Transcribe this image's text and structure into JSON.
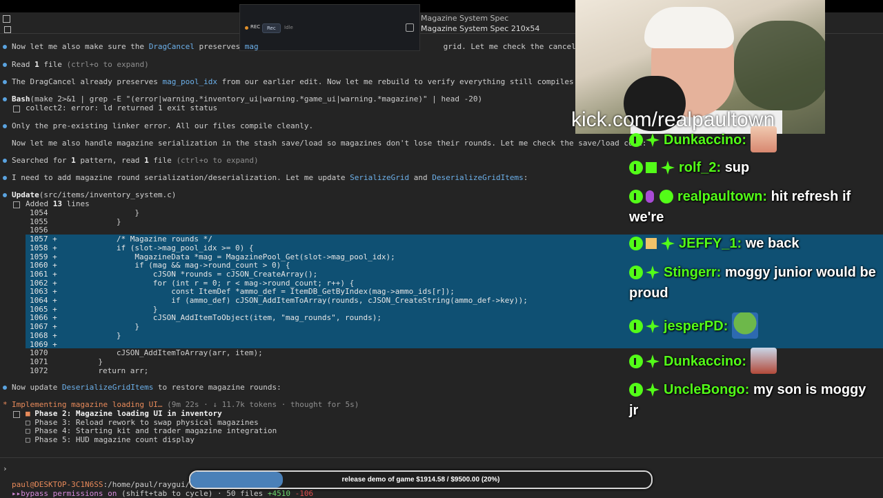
{
  "window": {
    "title": "Magazine System Spec",
    "subtitle": "Magazine System Spec 210x54"
  },
  "recorder": {
    "rec_label": "REC",
    "rec_button": "Rec",
    "idle_button": "Idle"
  },
  "messages": {
    "m1_a": "Now let me also make sure the ",
    "m1_b": "DragCancel",
    "m1_c": " preserves ",
    "m1_d": "mag",
    "m1_e": "grid. Let me check the cancel path:",
    "m2_a": "Read ",
    "m2_b": "1",
    "m2_c": " file ",
    "m2_d": "(ctrl+o to expand)",
    "m3_a": "The DragCancel already preserves ",
    "m3_b": "mag_pool_idx",
    "m3_c": " from our earlier edit. Now let me rebuild to verify everything still compiles:",
    "m4_a": "Bash",
    "m4_b": "(make 2>&1 | grep -E \"(error|warning.*inventory_ui|warning.*game_ui|warning.*magazine)\" | head -20)",
    "m4_c": "collect2: error: ld returned 1 exit status",
    "m5": "Only the pre-existing linker error. All our files compile cleanly.",
    "m6": "Now let me also handle magazine serialization in the stash save/load so magazines don't lose their rounds. Let me check the save/load code:",
    "m7_a": "Searched for ",
    "m7_b": "1",
    "m7_c": " pattern, read ",
    "m7_d": "1",
    "m7_e": " file ",
    "m7_f": "(ctrl+o to expand)",
    "m8_a": "I need to add magazine round serialization/deserialization. Let me update ",
    "m8_b": "SerializeGrid",
    "m8_c": " and ",
    "m8_d": "DeserializeGridItems",
    "m8_e": ":",
    "m9_a": "Update",
    "m9_b": "(src/items/inventory_system.c)",
    "m9_c_a": "Added ",
    "m9_c_b": "13",
    "m9_c_c": " lines",
    "m10_a": "Now update ",
    "m10_b": "DeserializeGridItems",
    "m10_c": " to restore magazine rounds:",
    "m11_a": "Implementing magazine loading UI… ",
    "m11_b": "(9m 22s · ↓ 11.7k tokens · thought for 5s)"
  },
  "code_lines": [
    {
      "n": "1054",
      "s": " ",
      "t": "                }"
    },
    {
      "n": "1055",
      "s": " ",
      "t": "            }"
    },
    {
      "n": "1056",
      "s": " ",
      "t": ""
    },
    {
      "n": "1057",
      "s": "+",
      "t": "            /* Magazine rounds */"
    },
    {
      "n": "1058",
      "s": "+",
      "t": "            if (slot->mag_pool_idx >= 0) {"
    },
    {
      "n": "1059",
      "s": "+",
      "t": "                MagazineData *mag = MagazinePool_Get(slot->mag_pool_idx);"
    },
    {
      "n": "1060",
      "s": "+",
      "t": "                if (mag && mag->round_count > 0) {"
    },
    {
      "n": "1061",
      "s": "+",
      "t": "                    cJSON *rounds = cJSON_CreateArray();"
    },
    {
      "n": "1062",
      "s": "+",
      "t": "                    for (int r = 0; r < mag->round_count; r++) {"
    },
    {
      "n": "1063",
      "s": "+",
      "t": "                        const ItemDef *ammo_def = ItemDB_GetByIndex(mag->ammo_ids[r]);"
    },
    {
      "n": "1064",
      "s": "+",
      "t": "                        if (ammo_def) cJSON_AddItemToArray(rounds, cJSON_CreateString(ammo_def->key));"
    },
    {
      "n": "1065",
      "s": "+",
      "t": "                    }"
    },
    {
      "n": "1066",
      "s": "+",
      "t": "                    cJSON_AddItemToObject(item, \"mag_rounds\", rounds);"
    },
    {
      "n": "1067",
      "s": "+",
      "t": "                }"
    },
    {
      "n": "1068",
      "s": "+",
      "t": "            }"
    },
    {
      "n": "1069",
      "s": "+",
      "t": ""
    },
    {
      "n": "1070",
      "s": " ",
      "t": "            cJSON_AddItemToArray(arr, item);"
    },
    {
      "n": "1071",
      "s": " ",
      "t": "        }"
    },
    {
      "n": "1072",
      "s": " ",
      "t": "        return arr;"
    }
  ],
  "todos": [
    {
      "mark": "■",
      "text": "Phase 2: Magazine loading UI in inventory",
      "active": true
    },
    {
      "mark": "□",
      "text": "Phase 3: Reload rework to swap physical magazines",
      "active": false
    },
    {
      "mark": "□",
      "text": "Phase 4: Starting kit and trader magazine integration",
      "active": false
    },
    {
      "mark": "□",
      "text": "Phase 5: HUD magazine count display",
      "active": false
    }
  ],
  "stream": {
    "url": "kick.com/realpaultown"
  },
  "chat": [
    {
      "user": "Dunkaccino:",
      "msg": ""
    },
    {
      "user": "rolf_2:",
      "msg": "sup"
    },
    {
      "user": "realpaultown:",
      "msg": "hit refresh if we're"
    },
    {
      "user": "JEFFY_1:",
      "msg": "we back"
    },
    {
      "user": "Stingerr:",
      "msg": "moggy junior would be proud"
    },
    {
      "user": "jesperPD:",
      "msg": ""
    },
    {
      "user": "Dunkaccino:",
      "msg": ""
    },
    {
      "user": "UncleBongo:",
      "msg": "my son is moggy jr"
    }
  ],
  "statusbar": {
    "prompt": "›",
    "path_user": "paul@DESKTOP-3C1N6SS",
    "path_dir": ":/home/paul/raygui/p",
    "perm_icon": "▸▸",
    "perm_a": "bypass permissions on",
    "perm_b": " (shift+tab to cycle) · 50 files ",
    "perm_c": "+4510",
    "perm_d": " -106"
  },
  "goal": {
    "label": "release demo of game $1914.58 / $9500.00 (20%)",
    "fraction": 0.2
  },
  "colors": {
    "accent_blue": "#6cb0ea",
    "diff_add_band": "#0f5073",
    "kick_green": "#53fc18",
    "progress_fill": "#4a80b8"
  }
}
